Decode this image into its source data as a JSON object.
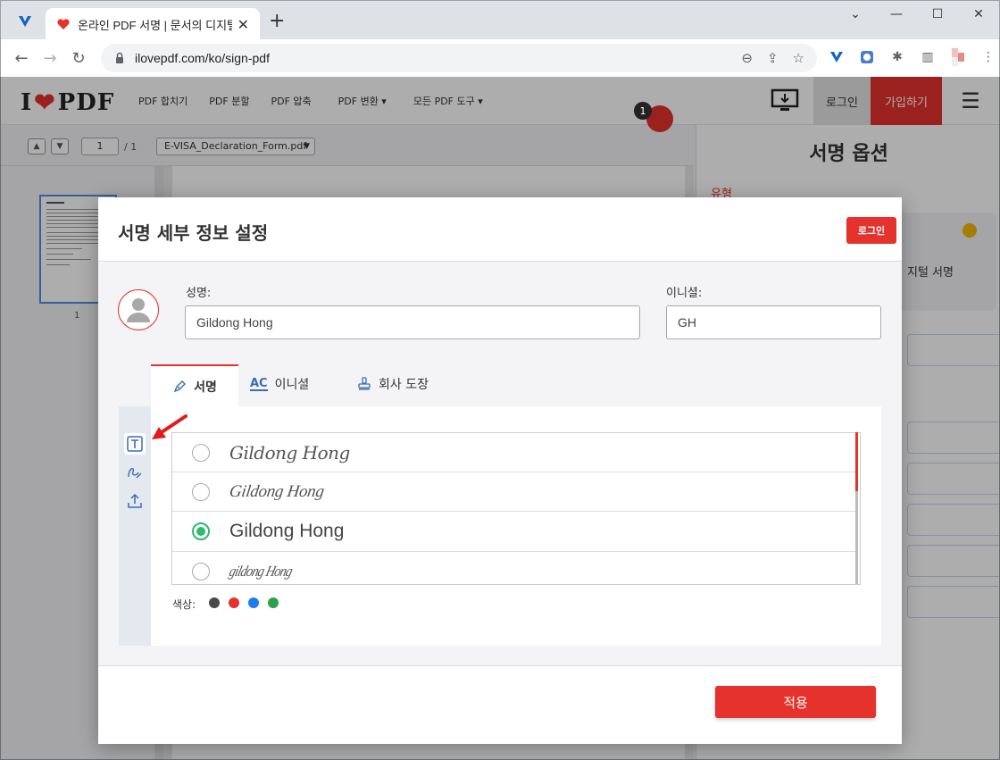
{
  "browser": {
    "tab_title": "온라인 PDF 서명 | 문서의 디지털",
    "url": "ilovepdf.com/ko/sign-pdf"
  },
  "site": {
    "logo": {
      "left": "I",
      "right": "PDF"
    },
    "nav": [
      "PDF 합치기",
      "PDF 분할",
      "PDF 압축",
      "PDF 변환 ▾",
      "모든 PDF 도구 ▾"
    ],
    "login": "로그인",
    "signup": "가입하기"
  },
  "viewer": {
    "page_input": "1",
    "page_total": "/ 1",
    "file_name": "E-VISA_Declaration_Form.pdf",
    "thumb_page_number": "1",
    "badge": "1"
  },
  "side_panel": {
    "title": "서명 옵션",
    "type_label": "유형",
    "card_text": "지털 서명"
  },
  "modal": {
    "title": "서명 세부 정보 설정",
    "login_button": "로그인",
    "name_label": "성명:",
    "name_value": "Gildong Hong",
    "initials_label": "이니셜:",
    "initials_value": "GH",
    "tabs": {
      "signature": "서명",
      "initials_icon": "AC",
      "initials": "이니셜",
      "stamp": "회사 도장"
    },
    "signature_options": [
      {
        "text": "Gildong Hong",
        "selected": false
      },
      {
        "text": "Gildong Hong",
        "selected": false
      },
      {
        "text": "Gildong Hong",
        "selected": true
      },
      {
        "text": "gildong Hong",
        "selected": false
      }
    ],
    "color_label": "색상:",
    "colors": [
      "#4a4a4a",
      "#e5322d",
      "#1a7ef2",
      "#2ca04a"
    ],
    "apply_button": "적용"
  },
  "icons": {
    "tools": [
      "text-tool-icon",
      "draw-tool-icon",
      "upload-tool-icon"
    ]
  }
}
